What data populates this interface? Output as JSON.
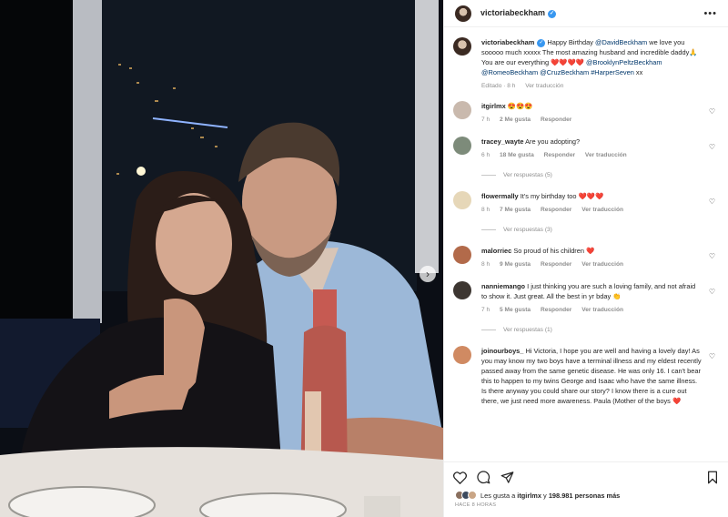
{
  "post": {
    "username": "victoriabeckham",
    "verified": true,
    "more_icon": "more-icon"
  },
  "caption": {
    "username": "victoriabeckham",
    "text_start": "Happy Birthday",
    "mention_david": "@DavidBeckham",
    "text_mid": "we love you sooooo much xxxxx The most amazing husband and incredible daddy",
    "text_end": "You are our everything",
    "mention_brooklyn": "@BrooklynPeltzBeckham",
    "mention_romeo": "@RomeoBeckham",
    "mention_cruz": "@CruzBeckham",
    "mention_harper": "#HarperSeven",
    "tail": "xx",
    "edited": "Editado · 8 h",
    "translate": "Ver traducción"
  },
  "comments": [
    {
      "user": "itgirlmx",
      "text": "",
      "emoji": "😍😍😍",
      "time": "7 h",
      "likes": "2 Me gusta",
      "reply": "Responder",
      "translate": "",
      "replies": "",
      "avatar_color": "#c9b9ad"
    },
    {
      "user": "tracey_wayte",
      "text": "Are you adopting?",
      "emoji": "",
      "time": "6 h",
      "likes": "18 Me gusta",
      "reply": "Responder",
      "translate": "Ver traducción",
      "replies": "Ver respuestas (5)",
      "avatar_color": "#7d8b7a"
    },
    {
      "user": "flowermally",
      "text": "It's my birthday too",
      "emoji": "❤️❤️❤️",
      "time": "8 h",
      "likes": "7 Me gusta",
      "reply": "Responder",
      "translate": "Ver traducción",
      "replies": "Ver respuestas (3)",
      "avatar_color": "#e6d7b8"
    },
    {
      "user": "malorriec",
      "text": "So proud of his children",
      "emoji": "❤️",
      "time": "8 h",
      "likes": "9 Me gusta",
      "reply": "Responder",
      "translate": "Ver traducción",
      "replies": "",
      "avatar_color": "#b26a4a"
    },
    {
      "user": "nanniemango",
      "text": "I just thinking you are such a loving family, and not afraid to show it. Just great. All the best in yr bday",
      "emoji": "👏",
      "time": "7 h",
      "likes": "5 Me gusta",
      "reply": "Responder",
      "translate": "Ver traducción",
      "replies": "Ver respuestas (1)",
      "avatar_color": "#3d3631"
    },
    {
      "user": "joinourboys_",
      "text": "Hi Victoria, I hope you are well and having a lovely day! As you may know my two boys have a terminal illness and my eldest recently passed away from the same genetic disease. He was only 16. I can't bear this to happen to my twins George and Isaac who have the same illness. Is there anyway you could share our story? I know there is a cure out there, we just need more awareness. Paula (Mother of the boys",
      "emoji": "❤️",
      "time": "",
      "likes": "",
      "reply": "",
      "translate": "",
      "replies": "",
      "avatar_color": "#d08a62"
    }
  ],
  "actions": {
    "like_icon": "heart-icon",
    "comment_icon": "comment-icon",
    "share_icon": "send-icon",
    "save_icon": "bookmark-icon"
  },
  "likes": {
    "prefix": "Les gusta a",
    "user": "itgirlmx",
    "middle": "y",
    "count": "198.981 personas más"
  },
  "timestamp": "HACE 8 HORAS"
}
